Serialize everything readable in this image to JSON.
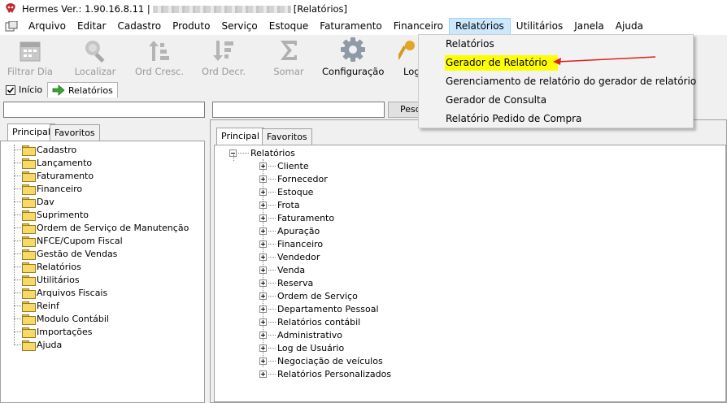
{
  "window": {
    "title_prefix": "Hermes Ver.: 1.90.16.8.11 |",
    "title_suffix": "[Relatórios]"
  },
  "menu": {
    "items": [
      "Arquivo",
      "Editar",
      "Cadastro",
      "Produto",
      "Serviço",
      "Estoque",
      "Faturamento",
      "Financeiro",
      "Relatórios",
      "Utilitários",
      "Janela",
      "Ajuda"
    ],
    "active": "Relatórios"
  },
  "toolbar": {
    "buttons": [
      {
        "label": "Filtrar Dia",
        "icon": "calendar-icon",
        "enabled": false
      },
      {
        "label": "Localizar",
        "icon": "magnifier-icon",
        "enabled": false
      },
      {
        "label": "Ord Cresc.",
        "icon": "sort-ascending-icon",
        "enabled": false
      },
      {
        "label": "Ord Decr.",
        "icon": "sort-descending-icon",
        "enabled": false
      },
      {
        "label": "Somar",
        "icon": "sigma-icon",
        "enabled": false
      },
      {
        "label": "Configuração",
        "icon": "gear-icon",
        "enabled": true
      },
      {
        "label": "Log",
        "icon": "key-icon",
        "enabled": true
      }
    ]
  },
  "doc_tabs": [
    {
      "label": "Início",
      "icon": "checkbox-icon",
      "selected": false
    },
    {
      "label": "Relatórios",
      "icon": "green-arrow-icon",
      "selected": true
    }
  ],
  "left_pane": {
    "search_value": "",
    "tabs": [
      "Principal",
      "Favoritos"
    ],
    "selected_tab": "Principal",
    "tree": [
      "Cadastro",
      "Lançamento",
      "Faturamento",
      "Financeiro",
      "Dav",
      "Suprimento",
      "Ordem de Serviço de Manutenção",
      "NFCE/Cupom Fiscal",
      "Gestão de Vendas",
      "Relatórios",
      "Utilitários",
      "Arquivos Fiscais",
      "Reinf",
      "Modulo Contábil",
      "Importações",
      "Ajuda"
    ]
  },
  "right_pane": {
    "search_value": "",
    "search_button": "Pesq",
    "tabs": [
      "Principal",
      "Favoritos"
    ],
    "selected_tab": "Principal",
    "root": "Relatórios",
    "children": [
      "Cliente",
      "Fornecedor",
      "Estoque",
      "Frota",
      "Faturamento",
      "Apuração",
      "Financeiro",
      "Vendedor",
      "Venda",
      "Reserva",
      "Ordem de Serviço",
      "Departamento Pessoal",
      "Relatórios contábil",
      "Administrativo",
      "Log de Usuário",
      "Negociação de veículos",
      "Relatórios Personalizados"
    ]
  },
  "dropdown": {
    "items": [
      "Relatórios",
      "Gerador de Relatório",
      "Gerenciamento de relatório do gerador de relatório",
      "Gerador de Consulta",
      "Relatório Pedido de Compra"
    ],
    "highlighted": "Gerador de Relatório"
  },
  "colors": {
    "highlight": "#ffff00",
    "annotation_arrow": "#e02020",
    "menu_active": "#cce8ff"
  }
}
